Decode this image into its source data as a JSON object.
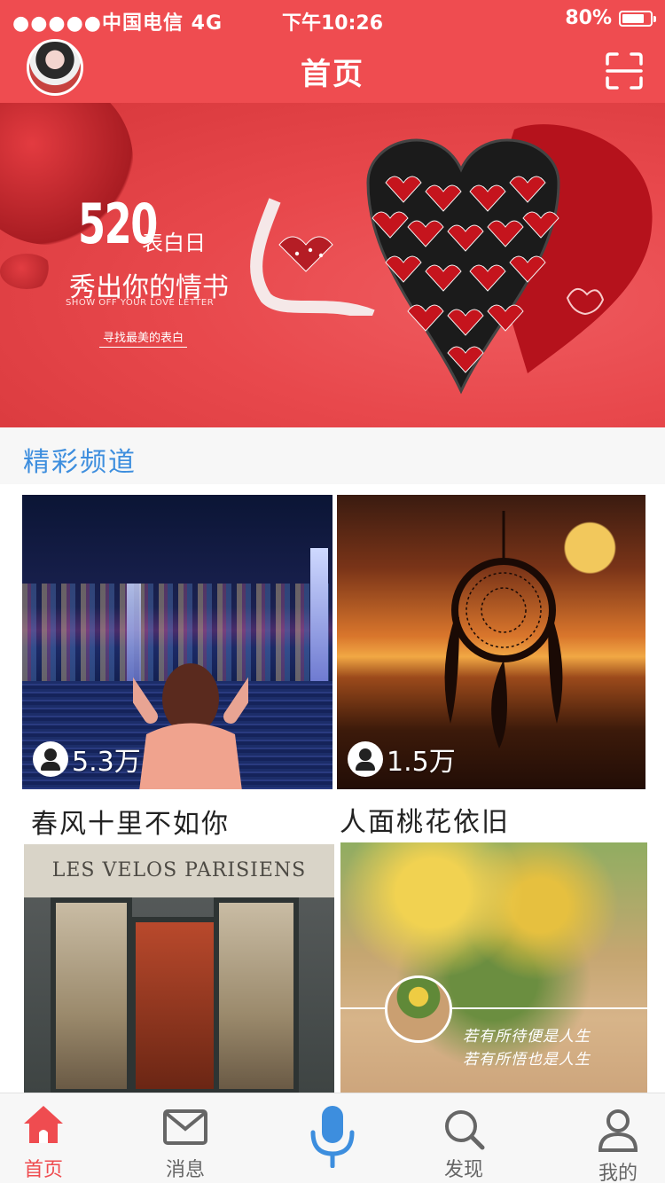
{
  "status_bar": {
    "carrier": "●●●●●中国电信  4G",
    "time": "下午10:26",
    "battery": "80%",
    "battery_level": 0.8
  },
  "header": {
    "title": "首页",
    "avatar_icon": "user-avatar",
    "scan_icon": "scan-icon"
  },
  "banner": {
    "number": "520",
    "sub1": "表白日",
    "sub2": "秀出你的情书",
    "english": "SHOW OFF YOUR LOVE LETTER",
    "cta": "寻找最美的表白",
    "ribbon_text": "love"
  },
  "section": {
    "title": "精彩频道"
  },
  "cards": [
    {
      "title": "春风十里不如你",
      "count": "5.3万"
    },
    {
      "title": "人面桃花依旧",
      "count": "1.5万"
    },
    {
      "sign_text": "LES VELOS  PARISIENS"
    },
    {
      "poem_line1": "若有所待便是人生",
      "poem_line2": "若有所悟也是人生"
    }
  ],
  "tabbar": {
    "items": [
      {
        "label": "首页",
        "icon": "home-icon",
        "active": true
      },
      {
        "label": "消息",
        "icon": "mail-icon",
        "active": false
      },
      {
        "label": "",
        "icon": "microphone-icon",
        "active": false
      },
      {
        "label": "发现",
        "icon": "search-icon",
        "active": false
      },
      {
        "label": "我的",
        "icon": "user-icon",
        "active": false
      }
    ]
  },
  "colors": {
    "brand": "#ef4c50",
    "section_title": "#3d8ede",
    "mic": "#3d8ede"
  }
}
